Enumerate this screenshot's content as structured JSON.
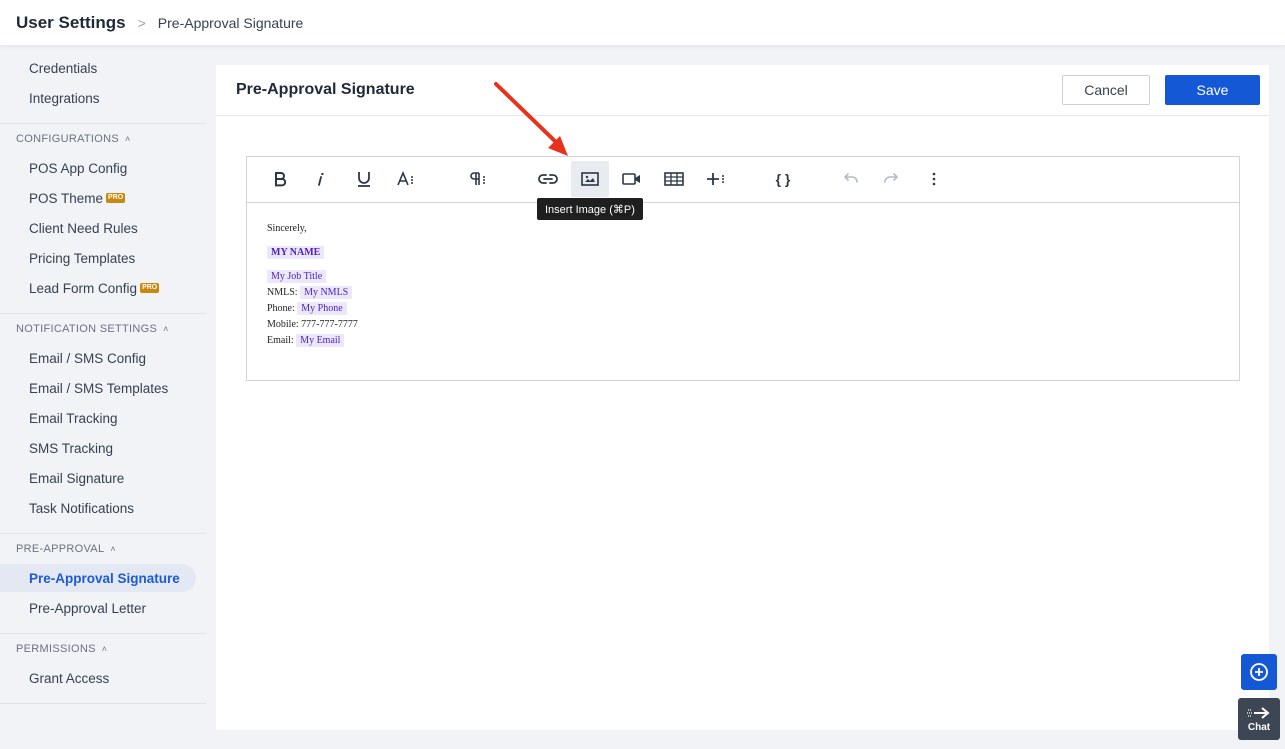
{
  "header": {
    "title": "User Settings",
    "separator": ">",
    "breadcrumb": "Pre-Approval Signature"
  },
  "sidebar": {
    "top_items": [
      {
        "label": "Credentials"
      },
      {
        "label": "Integrations"
      }
    ],
    "sections": [
      {
        "heading": "CONFIGURATIONS",
        "items": [
          {
            "label": "POS App Config"
          },
          {
            "label": "POS Theme",
            "badge": "PRO"
          },
          {
            "label": "Client Need Rules"
          },
          {
            "label": "Pricing Templates"
          },
          {
            "label": "Lead Form Config",
            "badge": "PRO"
          }
        ]
      },
      {
        "heading": "NOTIFICATION SETTINGS",
        "items": [
          {
            "label": "Email / SMS Config"
          },
          {
            "label": "Email / SMS Templates"
          },
          {
            "label": "Email Tracking"
          },
          {
            "label": "SMS Tracking"
          },
          {
            "label": "Email Signature"
          },
          {
            "label": "Task Notifications"
          }
        ]
      },
      {
        "heading": "PRE-APPROVAL",
        "items": [
          {
            "label": "Pre-Approval Signature",
            "active": true
          },
          {
            "label": "Pre-Approval Letter"
          }
        ]
      },
      {
        "heading": "PERMISSIONS",
        "items": [
          {
            "label": "Grant Access"
          }
        ]
      }
    ]
  },
  "panel": {
    "title": "Pre-Approval Signature",
    "cancel_label": "Cancel",
    "save_label": "Save"
  },
  "editor": {
    "tooltip": "Insert Image (⌘P)",
    "toolbar_icons": [
      "bold-icon",
      "italic-icon",
      "underline-icon",
      "font-size-icon",
      "paragraph-icon",
      "link-icon",
      "image-icon",
      "video-icon",
      "table-icon",
      "insert-more-icon",
      "code-braces-icon",
      "undo-icon",
      "redo-icon",
      "more-vertical-icon"
    ],
    "content": {
      "closing": "Sincerely,",
      "name_tag": "MY NAME",
      "job_title_tag": "My Job Title",
      "nmls_label": "NMLS:",
      "nmls_tag": "My NMLS",
      "phone_label": "Phone:",
      "phone_tag": "My Phone",
      "mobile": "Mobile: 777-777-7777",
      "email_label": "Email:",
      "email_tag": "My Email"
    }
  },
  "floating": {
    "chat_label": "Chat"
  },
  "colors": {
    "primary": "#1558d6",
    "tag_bg": "#ede7fb",
    "tag_text": "#4c22c2",
    "annotation_arrow": "#e8321e",
    "pro_badge": "#c9880e"
  }
}
